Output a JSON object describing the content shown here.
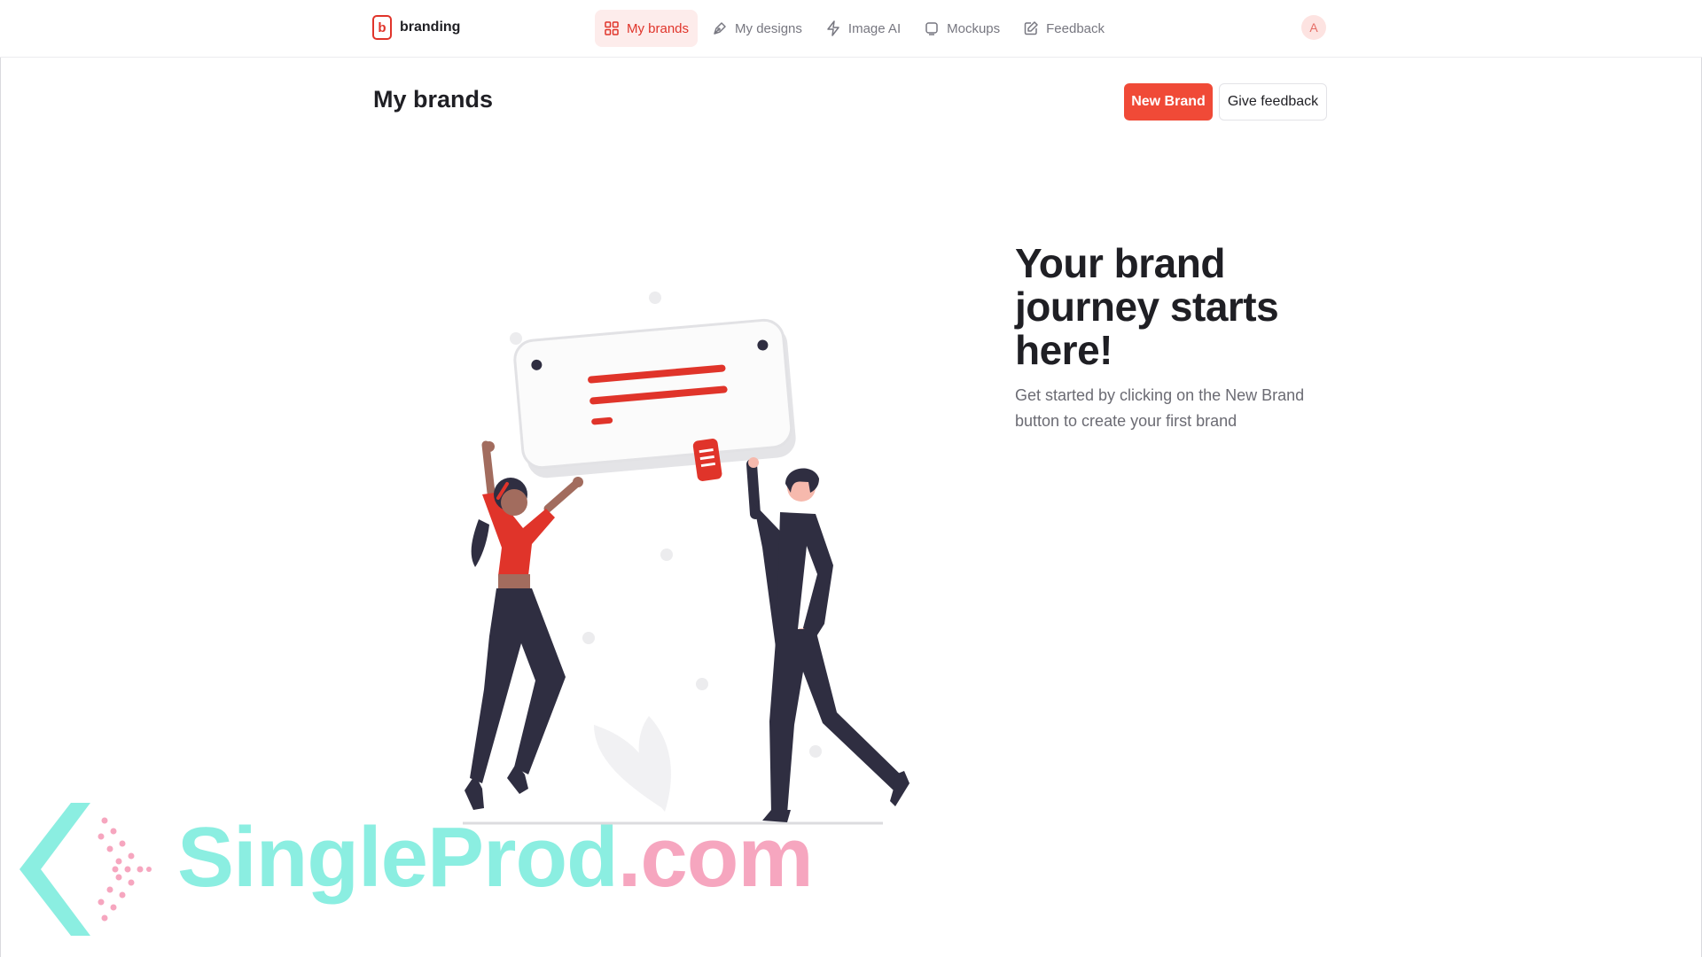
{
  "app": {
    "logo_letter": "b",
    "name": "branding"
  },
  "nav": {
    "items": [
      {
        "label": "My brands",
        "icon": "grid-icon",
        "active": true
      },
      {
        "label": "My designs",
        "icon": "pen-tool-icon",
        "active": false
      },
      {
        "label": "Image AI",
        "icon": "lightning-icon",
        "active": false
      },
      {
        "label": "Mockups",
        "icon": "square-icon",
        "active": false
      },
      {
        "label": "Feedback",
        "icon": "edit-icon",
        "active": false
      }
    ]
  },
  "user": {
    "avatar_initial": "A"
  },
  "page": {
    "title": "My brands",
    "new_brand_label": "New Brand",
    "give_feedback_label": "Give feedback"
  },
  "hero": {
    "title": "Your brand journey starts here!",
    "description": "Get started by clicking on the New Brand button to create your first brand"
  },
  "watermark": {
    "main": "SingleProd",
    "suffix": ".com"
  },
  "colors": {
    "accent": "#f04a37",
    "brand_red": "#e0342a",
    "active_bg": "#fdeceb",
    "figure_dark": "#2f2e41"
  }
}
